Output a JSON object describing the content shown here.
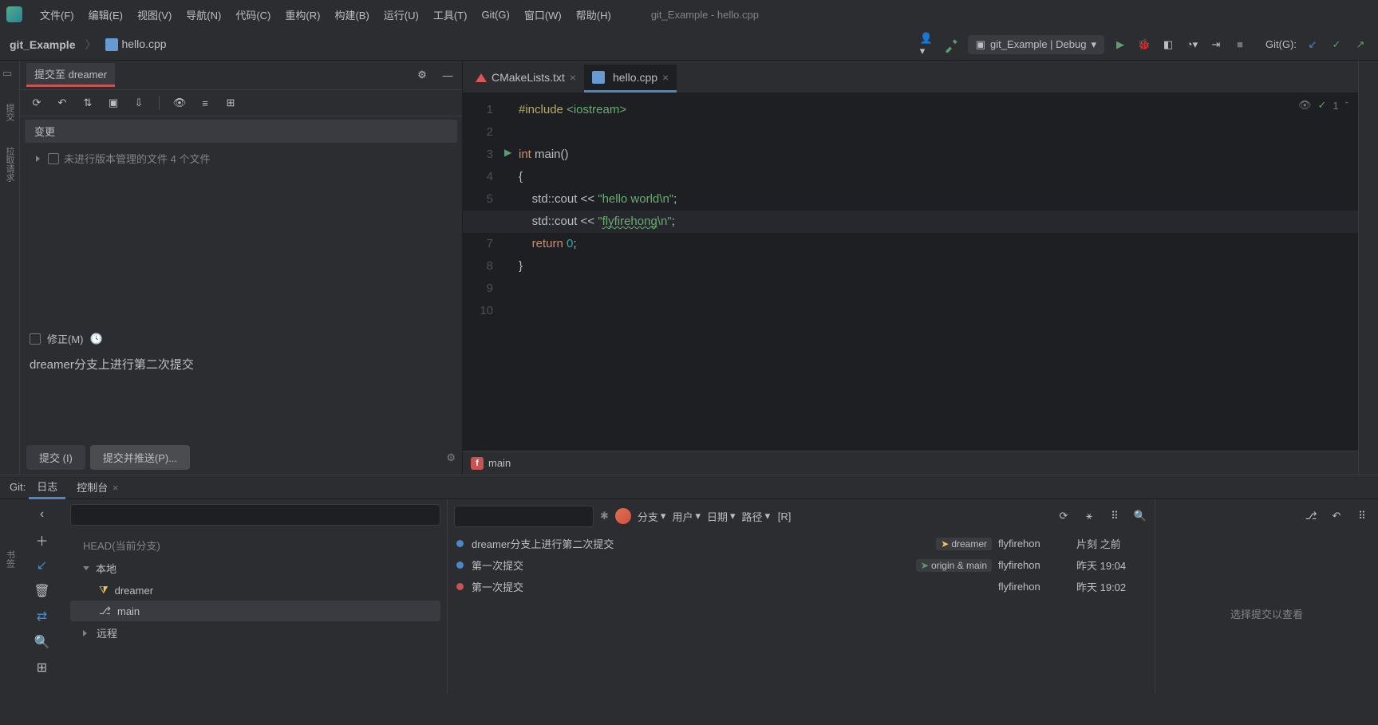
{
  "menubar": {
    "items": [
      "文件(F)",
      "编辑(E)",
      "视图(V)",
      "导航(N)",
      "代码(C)",
      "重构(R)",
      "构建(B)",
      "运行(U)",
      "工具(T)",
      "Git(G)",
      "窗口(W)",
      "帮助(H)"
    ],
    "window_title": "git_Example - hello.cpp"
  },
  "breadcrumb": {
    "project": "git_Example",
    "file": "hello.cpp"
  },
  "nav_right": {
    "run_config": "git_Example | Debug",
    "git_label": "Git(G):"
  },
  "commit_panel": {
    "tab": "提交至 dreamer",
    "changes_header": "变更",
    "unversioned": "未进行版本管理的文件 4 个文件",
    "amend": "修正(M)",
    "message": "dreamer分支上进行第二次提交",
    "commit_btn": "提交 (I)",
    "commit_push_btn": "提交并推送(P)..."
  },
  "editor": {
    "tabs": [
      {
        "name": "CMakeLists.txt",
        "active": false
      },
      {
        "name": "hello.cpp",
        "active": true
      }
    ],
    "status_count": "1",
    "footer_fn": "main",
    "code": {
      "l1_pp": "#include",
      "l1_inc": "<iostream>",
      "l3_kw": "int",
      "l3_fn": "main()",
      "l5_ns": "std",
      "l5_m": "cout",
      "l5_str": "\"hello world\\n\"",
      "l6_ns": "std",
      "l6_m": "cout",
      "l6_str_a": "\"",
      "l6_str_b": "flyfirehong",
      "l6_str_c": "\\n\"",
      "l7_kw": "return",
      "l7_n": "0"
    }
  },
  "bottom_tabs": {
    "label": "Git:",
    "log": "日志",
    "console": "控制台"
  },
  "git_log": {
    "head_label": "HEAD(当前分支)",
    "local": "本地",
    "branches": [
      "dreamer",
      "main"
    ],
    "remote": "远程",
    "filters": {
      "branch": "分支",
      "user": "用户",
      "date": "日期",
      "path": "路径"
    },
    "commits": [
      {
        "msg": "dreamer分支上进行第二次提交",
        "tags": [
          {
            "color": "y",
            "text": "dreamer"
          }
        ],
        "author": "flyfirehon",
        "date": "片刻 之前",
        "dot": "blue"
      },
      {
        "msg": "第一次提交",
        "tags": [
          {
            "color": "g",
            "text": "origin & main"
          }
        ],
        "author": "flyfirehon",
        "date": "昨天 19:04",
        "dot": "blue"
      },
      {
        "msg": "第一次提交",
        "tags": [],
        "author": "flyfirehon",
        "date": "昨天 19:02",
        "dot": "red"
      }
    ],
    "detail_placeholder": "选择提交以查看"
  },
  "left_vtabs": [
    "项目",
    "提交",
    "拉取请求"
  ],
  "bottom_vtabs": [
    "书签"
  ]
}
